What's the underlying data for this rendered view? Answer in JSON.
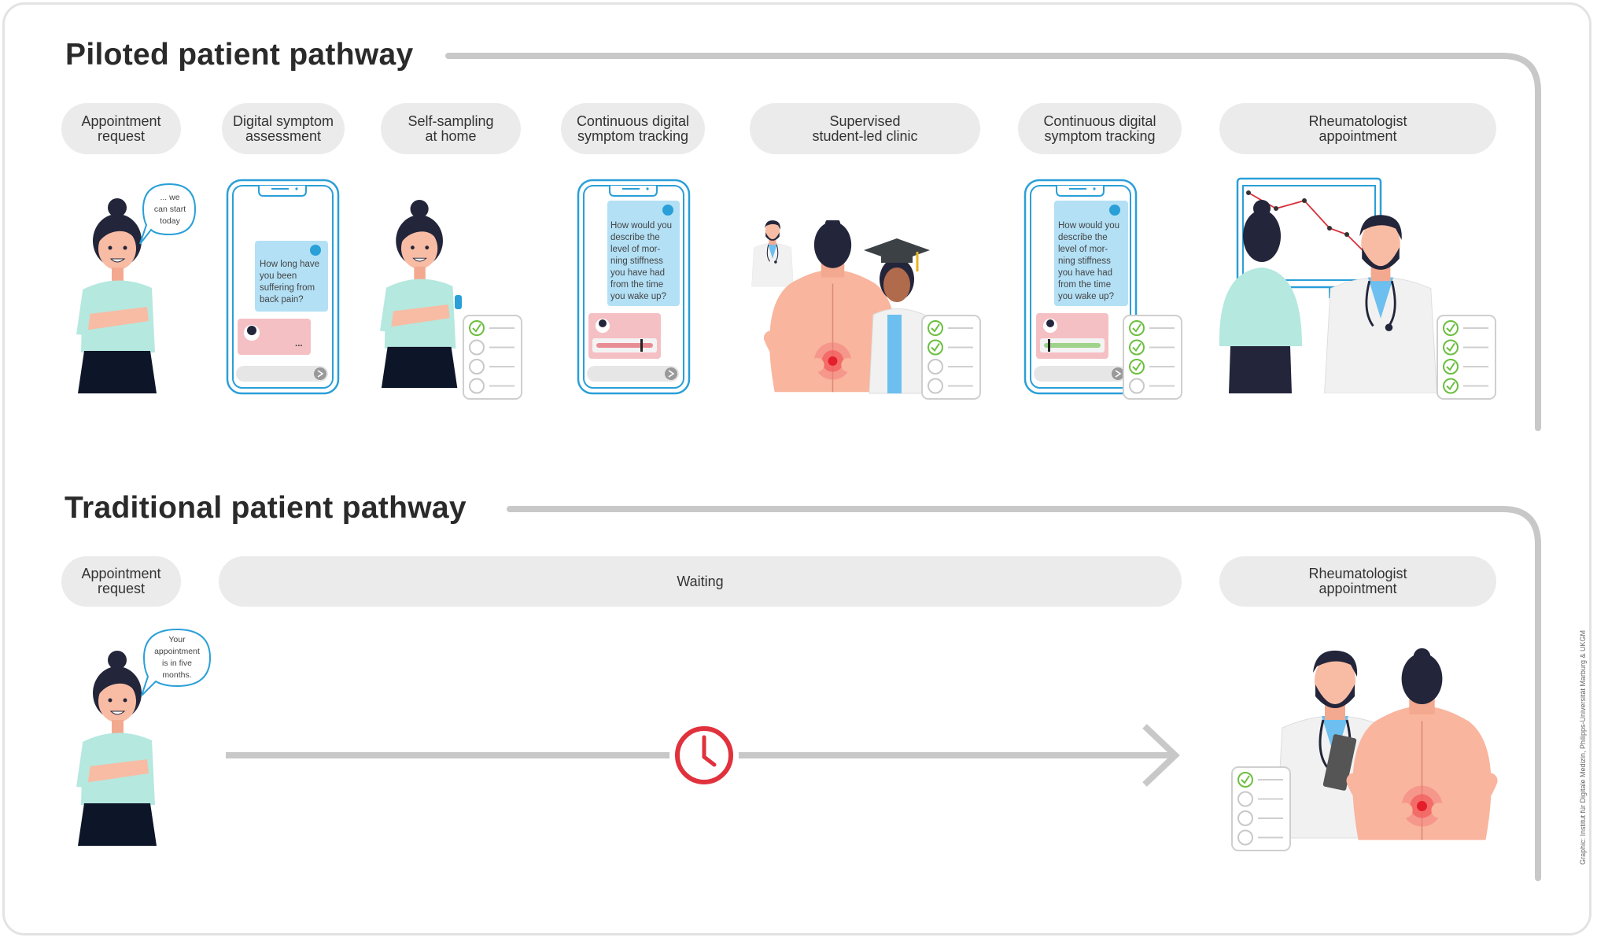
{
  "colors": {
    "pill_bg": "#ebebeb",
    "line": "#c8c8c8",
    "phone_blue": "#2a9fd8",
    "chat_blue": "#b3e0f5",
    "chat_pink": "#f5c0c4",
    "check_green": "#6cbf3f",
    "clock_red": "#e0323c",
    "hair": "#23253a",
    "skin": "#f8bca4",
    "shirt": "#b5e8df",
    "skirt": "#0d1628"
  },
  "piloted": {
    "title": "Piloted patient pathway",
    "steps": [
      {
        "label": "Appointment\nrequest"
      },
      {
        "label": "Digital symptom\nassessment"
      },
      {
        "label": "Self-sampling\nat home"
      },
      {
        "label": "Continuous digital\nsymptom tracking"
      },
      {
        "label": "Supervised\nstudent-led clinic"
      },
      {
        "label": "Continuous digital\nsymptom tracking"
      },
      {
        "label": "Rheumatologist\nappointment"
      }
    ],
    "speech": "... we\ncan start\ntoday",
    "chat_question_1": "How long have\nyou been\nsuffering from\nback pain?",
    "chat_typing": "...",
    "chat_question_2": "How would you\ndescribe the\nlevel of mor-\nning stiffness\nyou have had\nfrom the time\nyou wake up?",
    "chat_question_3": "How would you\ndescribe the\nlevel of mor-\nning stiffness\nyou have had\nfrom the time\nyou wake up?",
    "checklists_checked": {
      "self_sampling": 1,
      "clinic": 2,
      "tracking": 3,
      "rheumatologist": 4
    },
    "checklist_items": 4
  },
  "traditional": {
    "title": "Traditional patient pathway",
    "steps": [
      {
        "label": "Appointment\nrequest"
      },
      {
        "label": "Waiting"
      },
      {
        "label": "Rheumatologist\nappointment"
      }
    ],
    "speech": "Your\nappointment\nis in five\nmonths.",
    "checklist_checked": 1,
    "icons": [
      "clock-icon",
      "arrow-right-icon"
    ]
  },
  "credit": "Graphic: Institut für Digitale Medizin, Philipps-Universität Marburg & UKGM"
}
